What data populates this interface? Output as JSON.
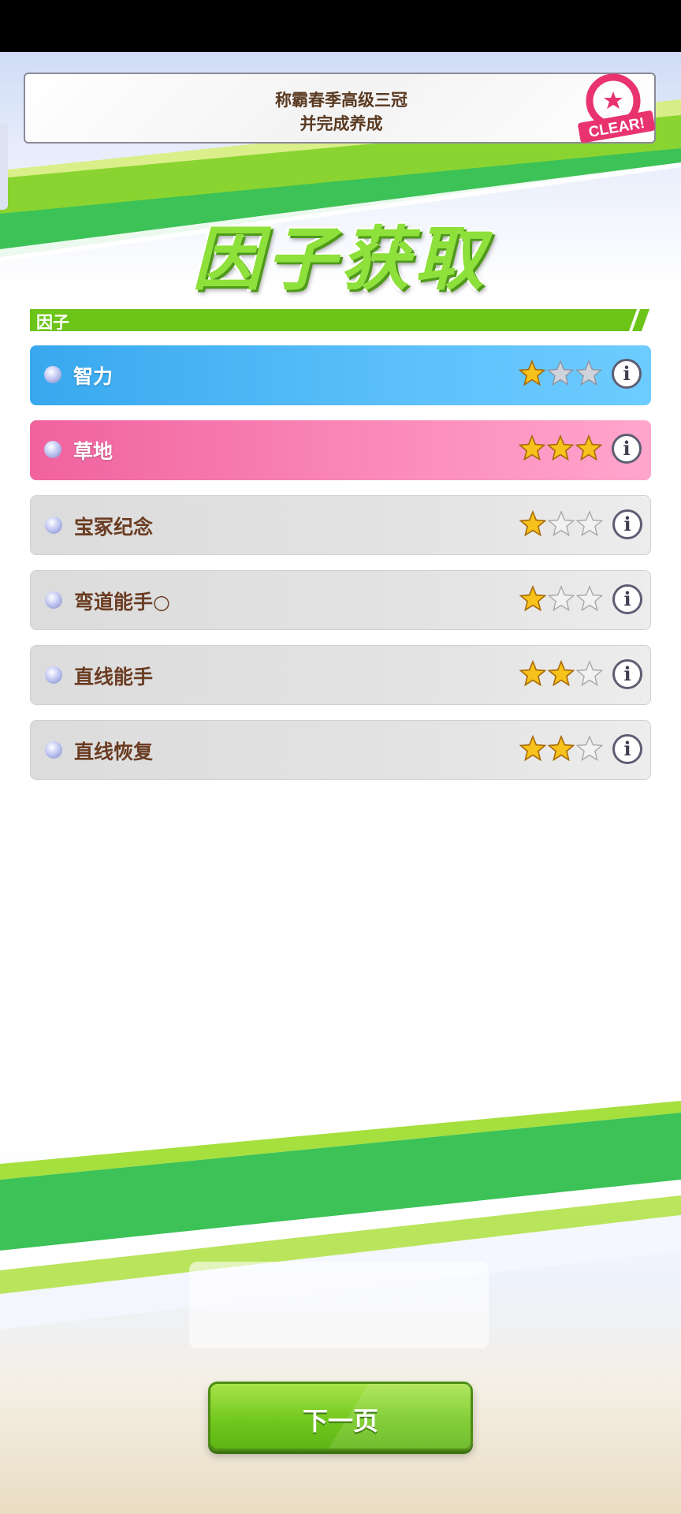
{
  "banner": {
    "line1": "称霸春季高级三冠",
    "line2": "并完成养成",
    "badge": "CLEAR!"
  },
  "title": "因子获取",
  "section_label": "因子",
  "factors": [
    {
      "name": "智力",
      "stars": 1,
      "max_stars": 3,
      "style": "blue"
    },
    {
      "name": "草地",
      "stars": 3,
      "max_stars": 3,
      "style": "pink"
    },
    {
      "name": "宝冢纪念",
      "stars": 1,
      "max_stars": 3,
      "style": "grey"
    },
    {
      "name": "弯道能手○",
      "stars": 1,
      "max_stars": 3,
      "style": "grey"
    },
    {
      "name": "直线能手",
      "stars": 2,
      "max_stars": 3,
      "style": "grey"
    },
    {
      "name": "直线恢复",
      "stars": 2,
      "max_stars": 3,
      "style": "grey"
    }
  ],
  "info_glyph": "i",
  "next_button": "下一页",
  "colors": {
    "accent_green": "#6cc418",
    "blue_factor": "#4db5f5",
    "pink_factor": "#f675ae",
    "grey_factor": "#e0e0e0",
    "label_brown": "#6a3c22",
    "clear_pink": "#e8336e"
  }
}
